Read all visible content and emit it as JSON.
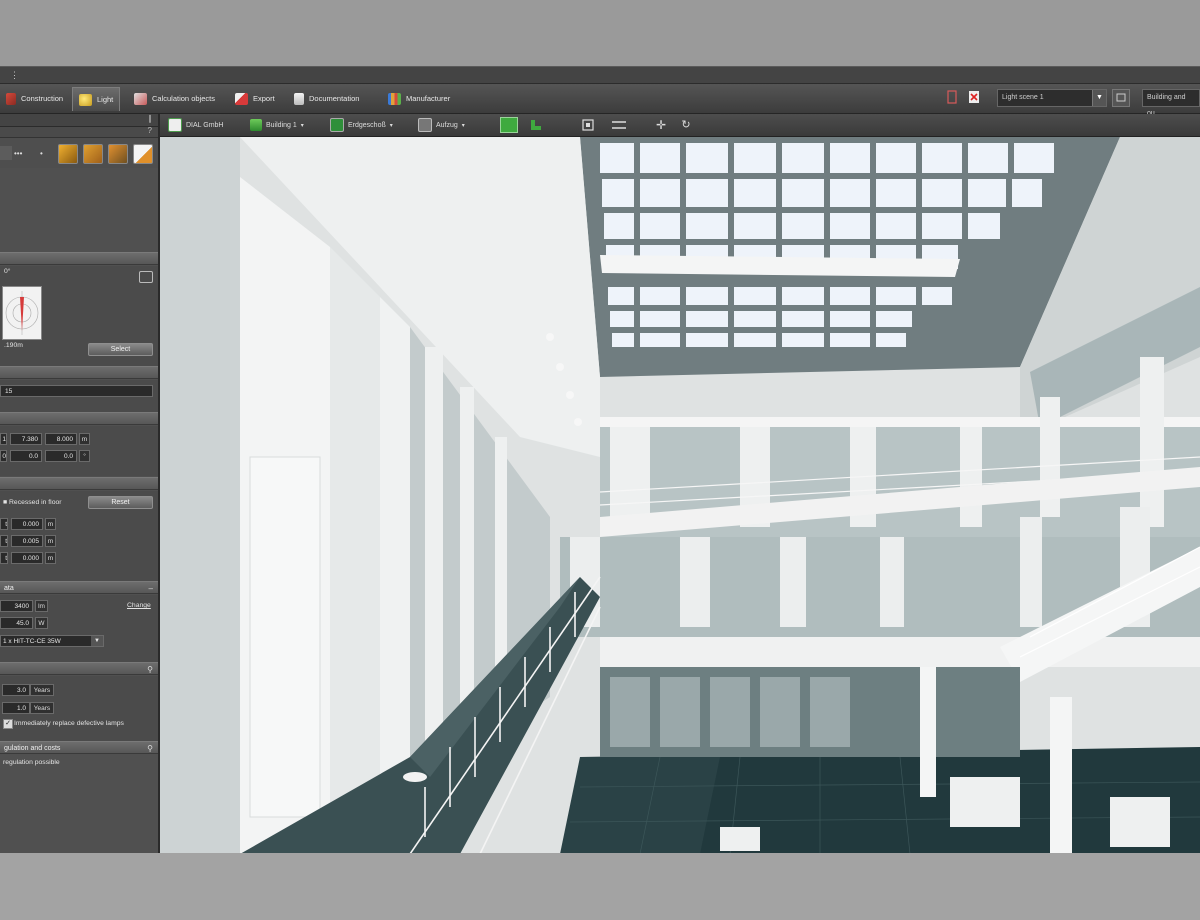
{
  "ribbon": {
    "tabs": [
      {
        "label": "Construction",
        "icon": "construction-icon",
        "color": "#d64a3b"
      },
      {
        "label": "Light",
        "icon": "light-icon",
        "color": "#e8c23a"
      },
      {
        "label": "Calculation objects",
        "icon": "calculation-objects-icon",
        "color": "#c85a5a"
      },
      {
        "label": "Export",
        "icon": "export-icon",
        "color": "#d83a3a"
      },
      {
        "label": "Documentation",
        "icon": "documentation-icon",
        "color": "#dcdcdc"
      },
      {
        "label": "Manufacturer",
        "icon": "manufacturer-icon",
        "color": "#e0a23a"
      }
    ],
    "light_scene": "Light scene 1",
    "view_mode": "Building and ou"
  },
  "panel": {
    "photometry_label": "0°",
    "distance_label": ".190m",
    "select_label": "Select",
    "name_value": "15",
    "position": {
      "x": "7.380",
      "y": "8.000",
      "unit1": "m",
      "r1": "0.0",
      "r2": "0.0",
      "unit2": "°"
    },
    "mounting": {
      "label": "Recessed in floor",
      "reset_label": "Reset",
      "v1": "0.000",
      "v2": "0.005",
      "v3": "0.000",
      "unit": "m"
    },
    "lamp": {
      "section": "ata",
      "flux": "3400",
      "flux_unit": "lm",
      "power": "45.0",
      "power_unit": "W",
      "change_label": "Change",
      "lamp_type": "1 x HIT-TC-CE 35W"
    },
    "maintenance": {
      "years1": "3.0",
      "years2": "1.0",
      "unit": "Years",
      "checkbox_label": "Immediately replace defective lamps"
    },
    "regulation": {
      "section": "gulation and costs",
      "text": "regulation possible"
    }
  },
  "view_toolbar": {
    "company": "DIAL GmbH",
    "building": "Building 1",
    "floor": "Erdgeschoß",
    "view": "Aufzug"
  }
}
